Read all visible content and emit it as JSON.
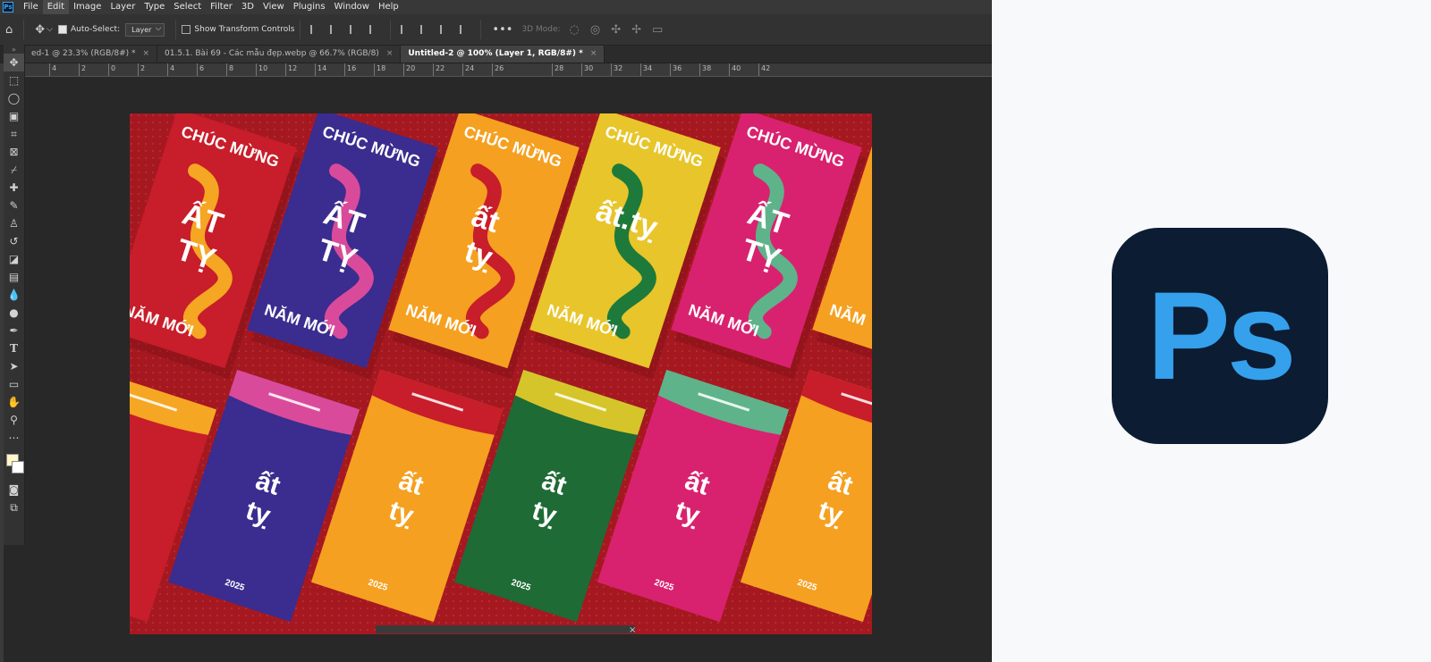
{
  "menu": {
    "app_icon": "Ps",
    "items": [
      "File",
      "Edit",
      "Image",
      "Layer",
      "Type",
      "Select",
      "Filter",
      "3D",
      "View",
      "Plugins",
      "Window",
      "Help"
    ]
  },
  "options": {
    "auto_select_label": "Auto-Select:",
    "auto_select_mode": "Layer",
    "show_transform_label": "Show Transform Controls",
    "mode_3d_label": "3D Mode:"
  },
  "tabs": [
    {
      "label": "ed-1 @ 23.3% (RGB/8#) *"
    },
    {
      "label": "01.5.1. Bài 69 - Các mẫu đẹp.webp @ 66.7% (RGB/8)"
    },
    {
      "label": "Untitled-2 @ 100% (Layer 1, RGB/8#) *"
    }
  ],
  "ruler": [
    "4",
    "2",
    "0",
    "2",
    "4",
    "6",
    "8",
    "10",
    "12",
    "14",
    "16",
    "18",
    "20",
    "22",
    "24",
    "26",
    "28",
    "30",
    "32",
    "34",
    "36",
    "38",
    "40",
    "42"
  ],
  "envelopes": {
    "top_row": [
      {
        "header": "CHÚC MỪNG",
        "main_1": "ẤT",
        "main_2": "TỴ",
        "footer": "NĂM MỚI",
        "bg": "#c81d2a",
        "accent": "#f5a623"
      },
      {
        "header": "CHÚC MỪNG",
        "main_1": "ẤT",
        "main_2": "TỴ",
        "footer": "NĂM MỚI",
        "bg": "#3b2c8f",
        "accent": "#d94b9a"
      },
      {
        "header": "CHÚC MỪNG",
        "main_1": "ất",
        "main_2": "tỵ",
        "footer": "NĂM MỚI",
        "bg": "#f5a020",
        "accent": "#c81d2a"
      },
      {
        "header": "CHÚC MỪNG",
        "main_1": "ất.tỵ",
        "main_2": "",
        "footer": "NĂM MỚI",
        "bg": "#e8c52a",
        "accent": "#1e7a3a"
      },
      {
        "header": "CHÚC MỪNG",
        "main_1": "ẤT",
        "main_2": "TỴ",
        "footer": "NĂM MỚI",
        "bg": "#d8226f",
        "accent": "#5fb38a"
      },
      {
        "header": "",
        "main_1": "",
        "main_2": "",
        "footer": "NĂM",
        "bg": "#f5a020",
        "accent": "#c81d2a"
      }
    ],
    "bottom_row": [
      {
        "line_1": "",
        "line_2": "",
        "year": "",
        "bg": "#c81d2a",
        "flap": "#f5a623"
      },
      {
        "line_1": "ất",
        "line_2": "tỵ",
        "year": "2025",
        "bg": "#3b2c8f",
        "flap": "#d94b9a"
      },
      {
        "line_1": "ất",
        "line_2": "tỵ",
        "year": "2025",
        "bg": "#f5a020",
        "flap": "#c81d2a"
      },
      {
        "line_1": "ất",
        "line_2": "tỵ",
        "year": "2025",
        "bg": "#1e6b35",
        "flap": "#d6c52a"
      },
      {
        "line_1": "ất",
        "line_2": "tỵ",
        "year": "2025",
        "bg": "#d8226f",
        "flap": "#5fb38a"
      },
      {
        "line_1": "ất",
        "line_2": "tỵ",
        "year": "2025",
        "bg": "#f5a020",
        "flap": "#c81d2a"
      }
    ]
  },
  "badge": {
    "text": "Ps"
  }
}
